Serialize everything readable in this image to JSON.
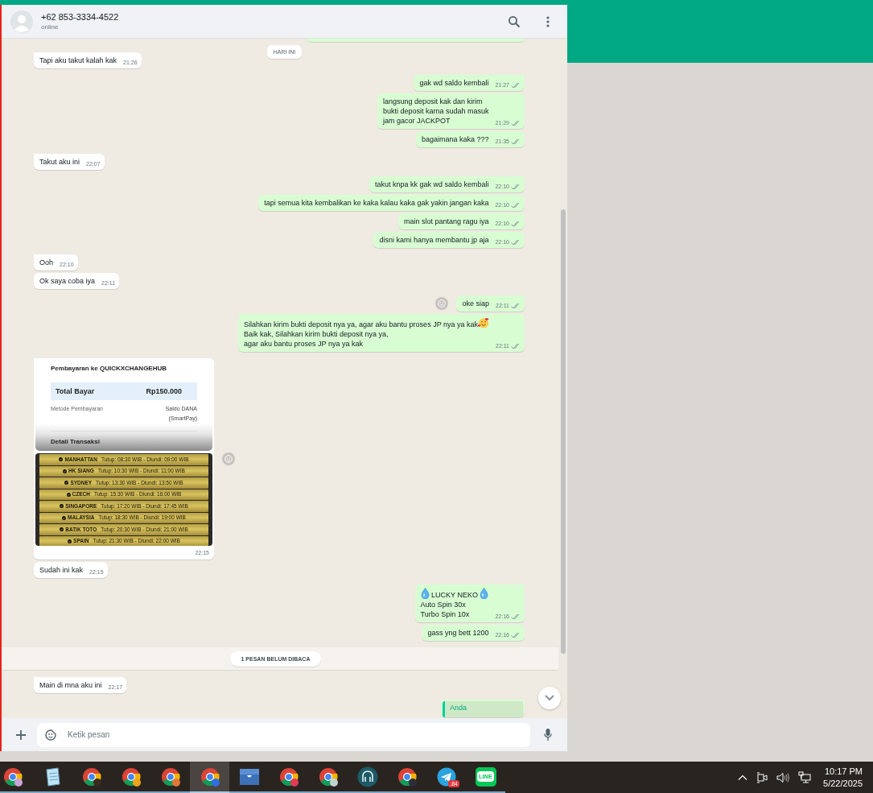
{
  "chat_header": {
    "contact_name": "+62 853-3334-4522",
    "status": "online"
  },
  "messages": [
    {
      "kind": "cut_bubble",
      "outgoing": true
    },
    {
      "kind": "date",
      "text": "HARI INI"
    },
    {
      "kind": "text",
      "outgoing": false,
      "tail": true,
      "text": "Tapi aku takut kalah kak",
      "time": "21:26",
      "reaction_button": false
    },
    {
      "kind": "text",
      "outgoing": true,
      "tail": true,
      "text": "gak wd saldo kembali",
      "time": "21:27",
      "read": false,
      "reaction_button": false
    },
    {
      "kind": "text",
      "outgoing": true,
      "tail": false,
      "text": "langsung deposit kak dan kirim\nbukti deposit karna sudah masuk\njam gacor JACKPOT",
      "time": "21:29",
      "read": false,
      "reaction_button": false
    },
    {
      "kind": "text",
      "outgoing": true,
      "tail": false,
      "text": "bagaimana kaka ???",
      "time": "21:35",
      "read": false,
      "reaction_button": false
    },
    {
      "kind": "text",
      "outgoing": false,
      "tail": true,
      "text": "Takut aku ini",
      "time": "22:07",
      "reaction_button": false
    },
    {
      "kind": "text",
      "outgoing": true,
      "tail": true,
      "text": "takut knpa kk gak wd saldo kembali",
      "time": "22:10",
      "read": false,
      "reaction_button": false
    },
    {
      "kind": "text",
      "outgoing": true,
      "tail": false,
      "text": "tapi semua kita kembalikan ke kaka kalau kaka gak yakin jangan kaka",
      "time": "22:10",
      "read": false,
      "reaction_button": false
    },
    {
      "kind": "text",
      "outgoing": true,
      "tail": false,
      "text": "main slot pantang ragu iya",
      "time": "22:10",
      "read": false,
      "reaction_button": false
    },
    {
      "kind": "text",
      "outgoing": true,
      "tail": false,
      "text": "disni kami hanya membantu jp aja",
      "time": "22:10",
      "read": false,
      "reaction_button": false
    },
    {
      "kind": "text",
      "outgoing": false,
      "tail": true,
      "text": "Ooh",
      "time": "22:10",
      "reaction_button": false
    },
    {
      "kind": "text",
      "outgoing": false,
      "tail": false,
      "text": "Ok saya coba iya",
      "time": "22:11",
      "reaction_button": false
    },
    {
      "kind": "text",
      "outgoing": true,
      "tail": true,
      "text": "oke siap",
      "time": "22:11",
      "read": false,
      "reaction_button": true
    },
    {
      "kind": "parts",
      "outgoing": true,
      "tail": false,
      "parts": [
        {
          "kind": "text",
          "text": "Silahkan kirim bukti deposit nya ya, agar aku bantu proses JP nya ya kak"
        },
        {
          "kind": "emoji_hearts"
        },
        {
          "kind": "br"
        },
        {
          "kind": "text",
          "text": "Baik kak, Silahkan kirim bukti deposit nya ya,\nagar aku bantu proses JP nya ya kak"
        }
      ],
      "time": "22:11",
      "read": false,
      "reaction_button": false
    },
    {
      "kind": "images",
      "outgoing": false,
      "tail": true,
      "time": "22:15",
      "reaction_button": true,
      "receipt": {
        "payee": "Pembayaran ke QUICKXCHANGEHUB",
        "total_label": "Total Bayar",
        "total": "Rp150.000",
        "method_label": "Metode Pembayaran",
        "method": "Saldo DANA\n(SmartPay)",
        "details": "Detail Transaksi"
      },
      "schedule": [
        {
          "market": "MANHATTAN",
          "hours": "Tutup: 08:30 WIB - Diundi: 09:00 WIB"
        },
        {
          "market": "HK SIANG",
          "hours": "Tutup: 10:30 WIB - Diundi: 11:00 WIB"
        },
        {
          "market": "SYDNEY",
          "hours": "Tutup: 13:30 WIB - Diundi: 13:50 WIB"
        },
        {
          "market": "CZECH",
          "hours": "Tutup: 15:30 WIB - Diundi: 16:00 WIB"
        },
        {
          "market": "SINGAPORE",
          "hours": "Tutup: 17:20 WIB - Diundi: 17:45 WIB"
        },
        {
          "market": "MALAYSIA",
          "hours": "Tutup: 18:30 WIB - Diundi: 19:00 WIB"
        },
        {
          "market": "BATIK TOTO",
          "hours": "Tutup: 20:30 WIB - Diundi: 21:00 WIB"
        },
        {
          "market": "SPAIN",
          "hours": "Tutup: 21:30 WIB - Diundi: 22:00 WIB"
        }
      ]
    },
    {
      "kind": "text",
      "outgoing": false,
      "tail": false,
      "text": "Sudah ini kak",
      "time": "22:15",
      "reaction_button": false
    },
    {
      "kind": "parts",
      "outgoing": true,
      "tail": true,
      "parts": [
        {
          "kind": "emoji_drop"
        },
        {
          "kind": "text",
          "text": " LUCKY NEKO "
        },
        {
          "kind": "emoji_drop"
        },
        {
          "kind": "br"
        },
        {
          "kind": "text",
          "text": "Auto Spin 30x\nTurbo Spin 10x"
        }
      ],
      "time": "22:16",
      "read": false,
      "reaction_button": false
    },
    {
      "kind": "text",
      "outgoing": true,
      "tail": false,
      "text": "gass yng bett 1200",
      "time": "22:16",
      "read": false,
      "reaction_button": false
    },
    {
      "kind": "unread",
      "text": "1 PESAN BELUM DIBACA"
    },
    {
      "kind": "text",
      "outgoing": false,
      "tail": true,
      "text": "Main di mna aku ini",
      "time": "22:17",
      "reaction_button": false
    },
    {
      "kind": "quote",
      "outgoing": true,
      "tail": true,
      "author": "Anda"
    }
  ],
  "composer": {
    "placeholder": "Ketik pesan"
  },
  "taskbar": {
    "apps": [
      {
        "kind": "chrome",
        "color": "#c9a3dc",
        "selected": false
      },
      {
        "kind": "notepad",
        "selected": false
      },
      {
        "kind": "chrome",
        "color": "#3b2a1e",
        "selected": false
      },
      {
        "kind": "chrome",
        "color": "#f2a31c",
        "selected": false
      },
      {
        "kind": "chrome",
        "color": "#e2773a",
        "selected": false
      },
      {
        "kind": "chrome",
        "color": "#2f6fe4",
        "selected": true
      },
      {
        "kind": "box",
        "selected": false
      },
      {
        "kind": "chrome",
        "color": "#e23a5a",
        "selected": false
      },
      {
        "kind": "chrome",
        "color": "#bfd3d0",
        "selected": false
      },
      {
        "kind": "octo",
        "selected": false
      },
      {
        "kind": "chrome",
        "color": "#2d2d3c",
        "selected": false
      },
      {
        "kind": "telegram",
        "badge": ".84",
        "selected": false
      },
      {
        "kind": "line",
        "label": "LINE",
        "selected": false
      }
    ],
    "clock": {
      "time": "10:17 PM",
      "date": "5/22/2025"
    }
  }
}
